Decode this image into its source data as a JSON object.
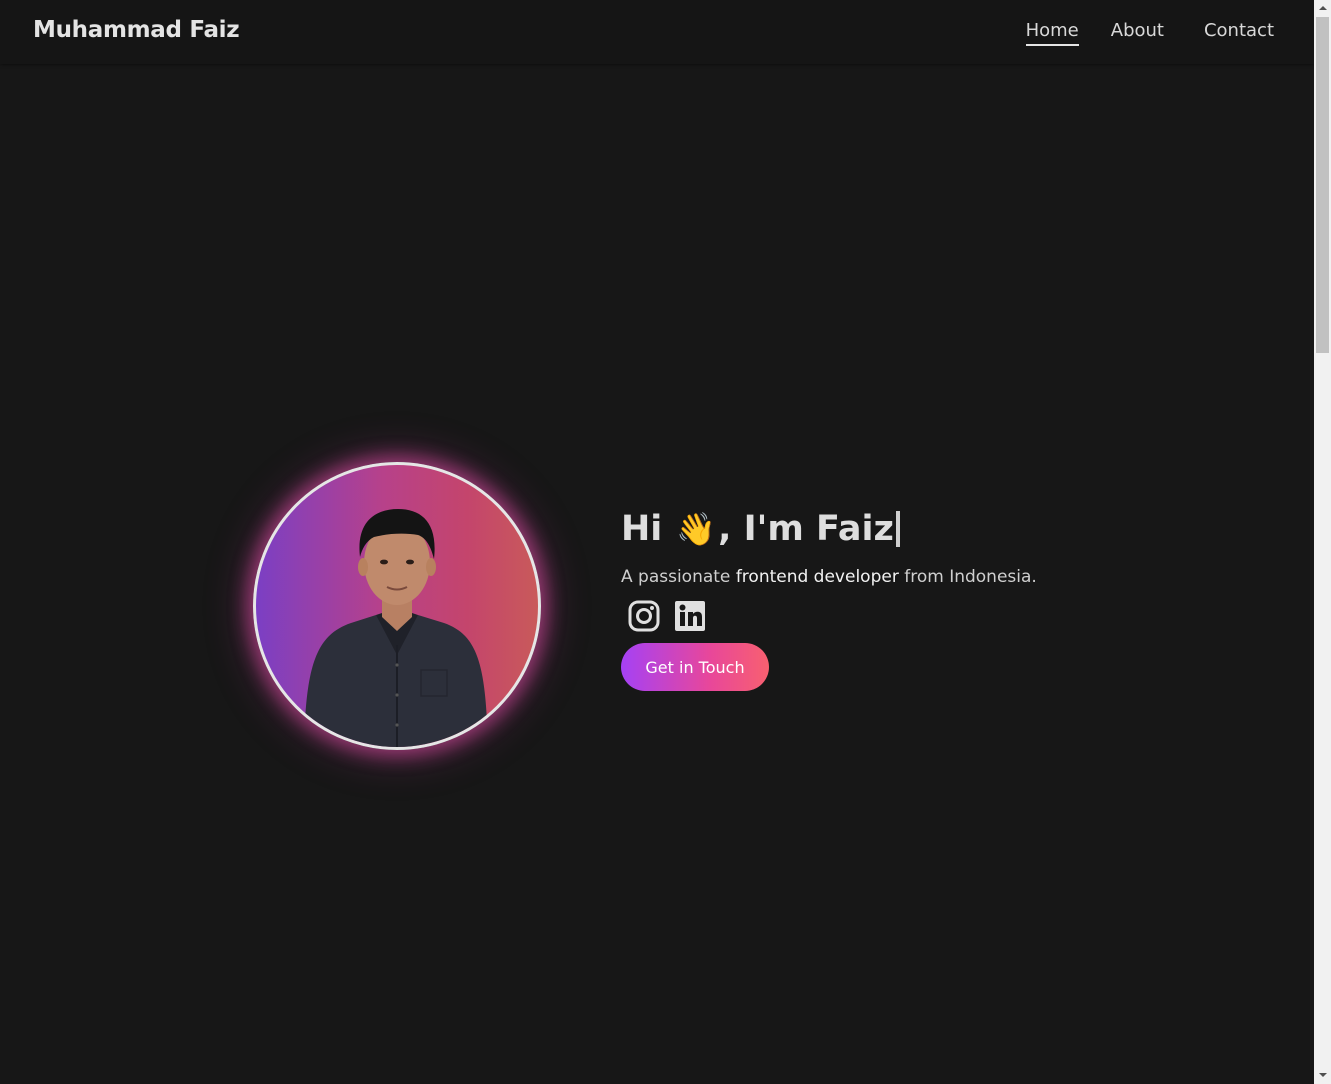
{
  "header": {
    "brand": "Muhammad Faiz",
    "nav": {
      "home": "Home",
      "about": "About",
      "contact": "Contact"
    }
  },
  "hero": {
    "greeting_prefix": "Hi",
    "wave_emoji": "👋",
    "greeting_suffix": ", I'm Faiz",
    "tagline_start": "A passionate ",
    "tagline_highlight": "frontend developer",
    "tagline_end": " from Indonesia.",
    "cta_label": "Get in Touch",
    "socials": [
      {
        "icon": "instagram-icon"
      },
      {
        "icon": "linkedin-icon"
      }
    ]
  },
  "colors": {
    "background": "#171717",
    "accent_start": "#a541f5",
    "accent_end": "#f86070"
  }
}
